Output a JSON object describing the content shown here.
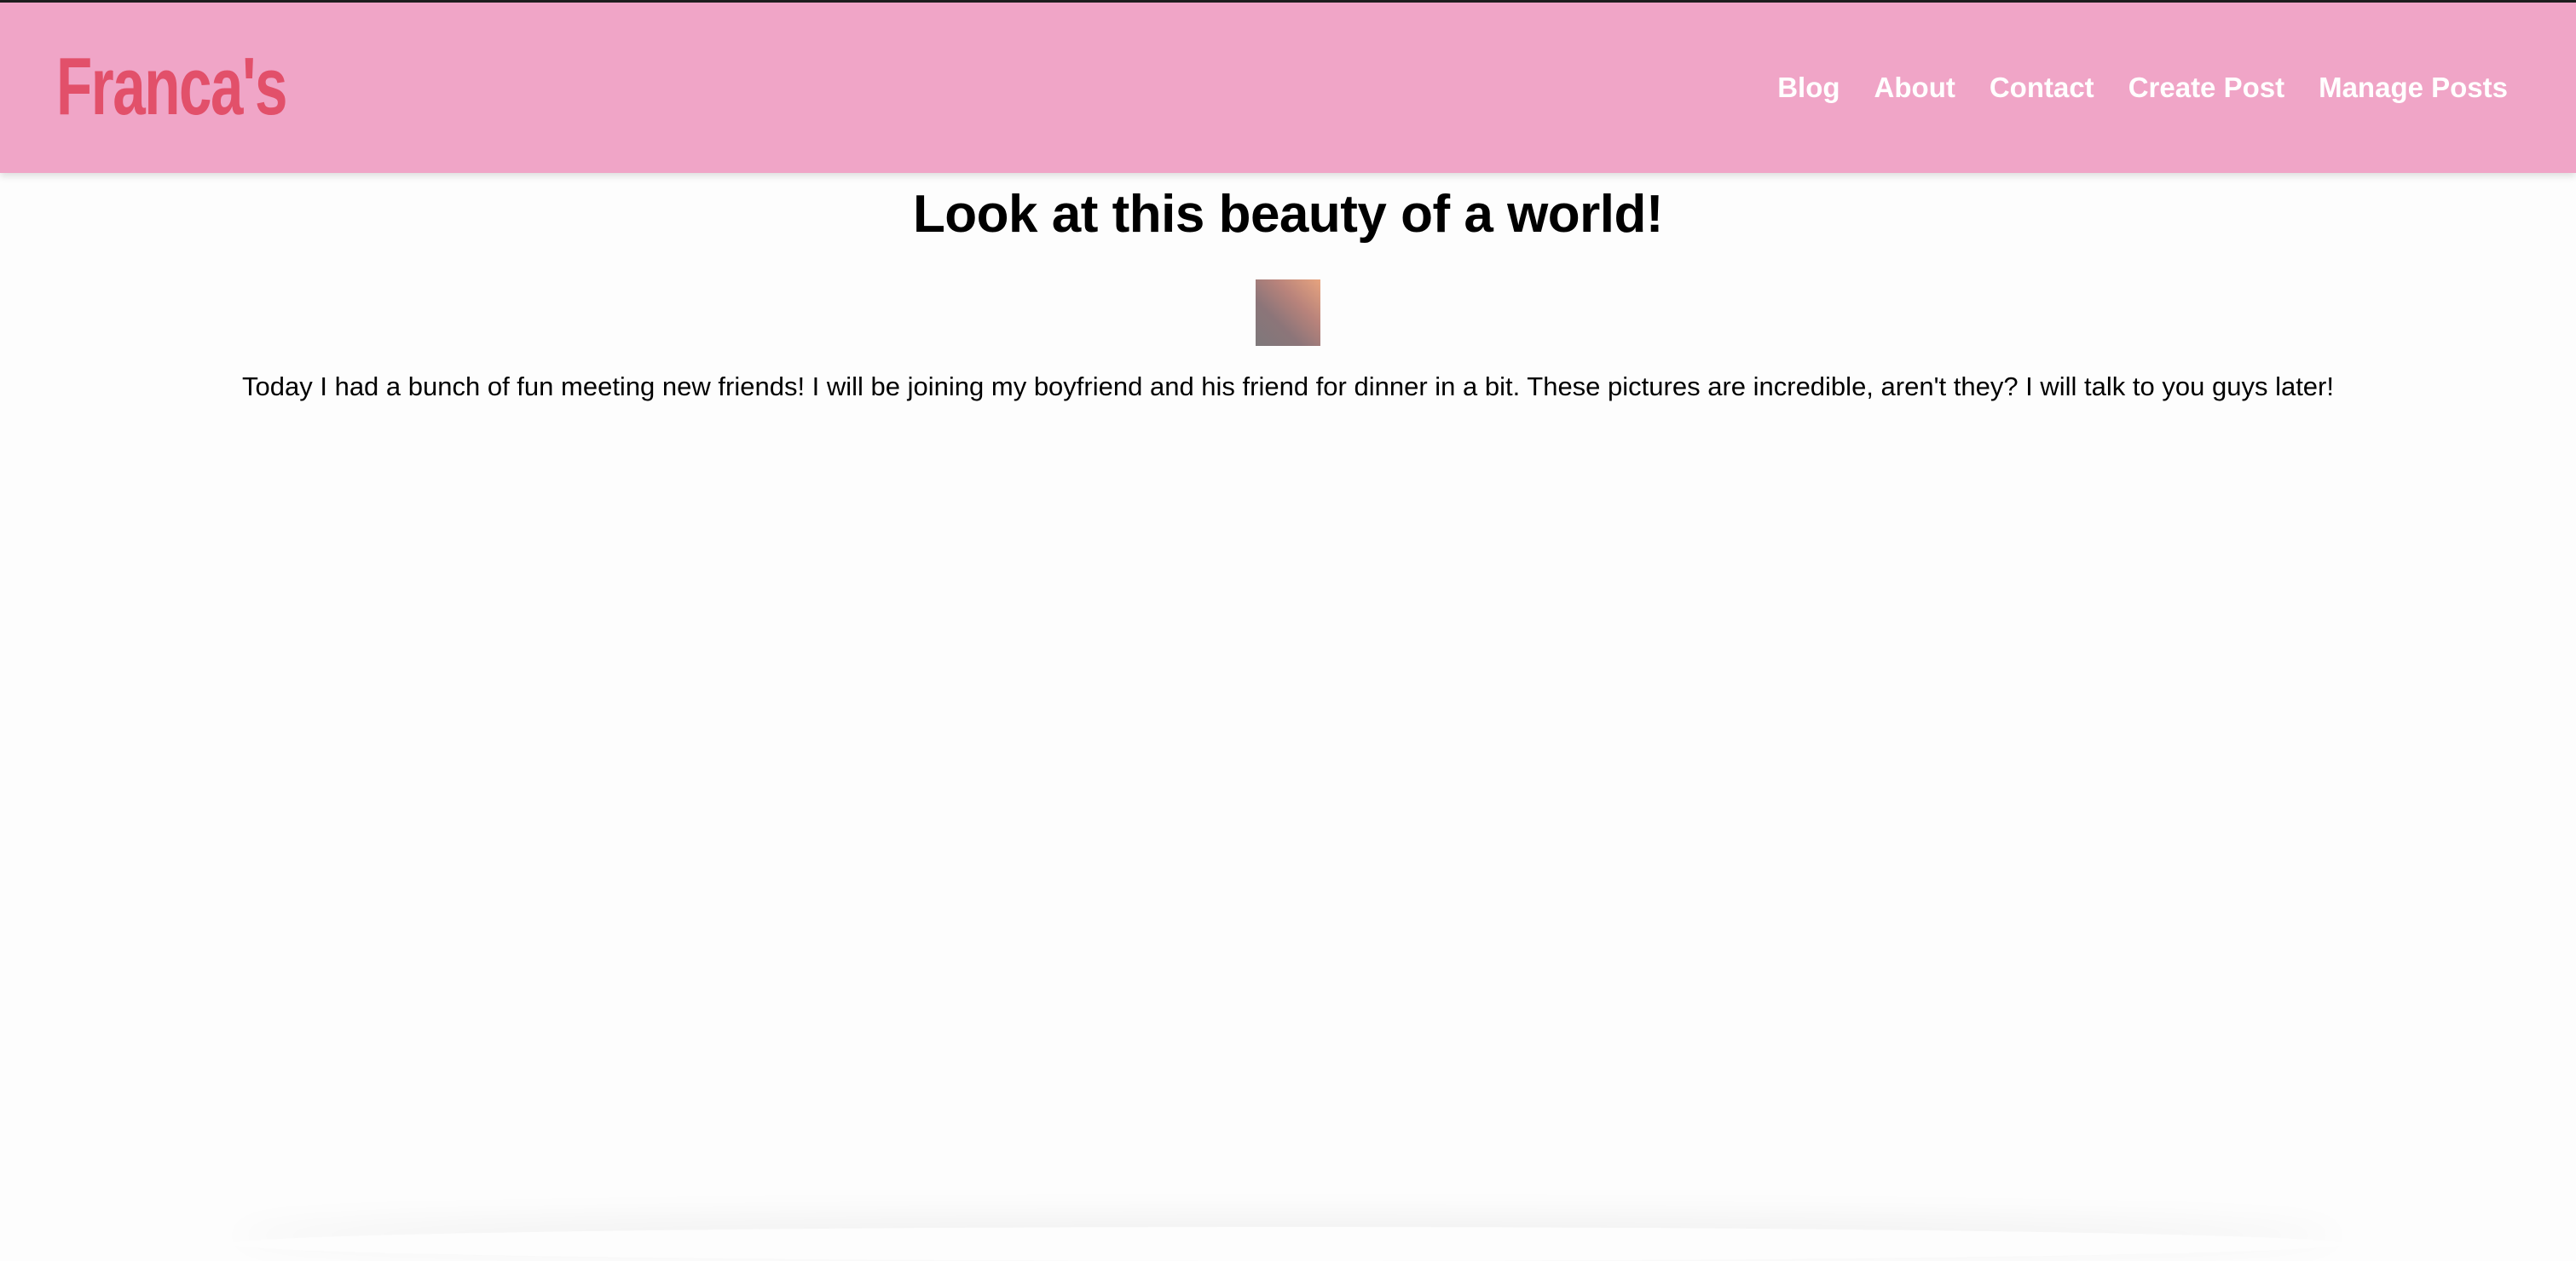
{
  "header": {
    "brand": "Franca's",
    "nav": [
      {
        "label": "Blog"
      },
      {
        "label": "About"
      },
      {
        "label": "Contact"
      },
      {
        "label": "Create Post"
      },
      {
        "label": "Manage Posts"
      }
    ]
  },
  "post": {
    "title": "Look at this beauty of a world!",
    "body": "Today I had a bunch of fun meeting new friends! I will be joining my boyfriend and his friend for dinner in a bit. These pictures are incredible, aren't they? I will talk to you guys later!"
  },
  "colors": {
    "header_bg": "#f0a5c7",
    "brand": "#e2506a",
    "nav_text": "#ffffff",
    "page_bg": "#fdfdfd"
  }
}
